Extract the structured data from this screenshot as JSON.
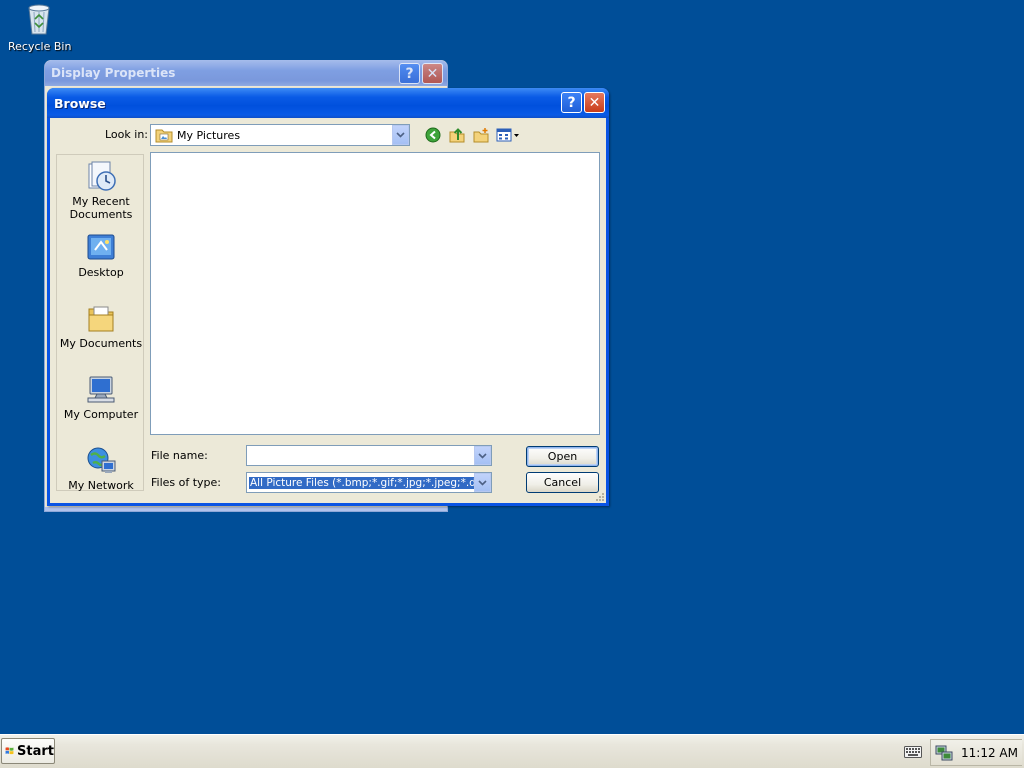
{
  "desktop": {
    "icons": [
      {
        "label": "Recycle Bin",
        "icon": "recycle-bin-icon"
      }
    ]
  },
  "background_window": {
    "title": "Display Properties",
    "help_glyph": "?",
    "close_glyph": "✕"
  },
  "dialog": {
    "title": "Browse",
    "help_glyph": "?",
    "close_glyph": "✕",
    "look_in": {
      "label": "Look in:",
      "value": "My Pictures",
      "icon": "my-pictures-folder-icon"
    },
    "toolbar": [
      {
        "name": "back",
        "icon": "back-arrow-icon"
      },
      {
        "name": "up-one-level",
        "icon": "up-folder-icon"
      },
      {
        "name": "create-new-folder",
        "icon": "new-folder-icon"
      },
      {
        "name": "view-menu",
        "icon": "view-menu-icon"
      }
    ],
    "places": [
      {
        "label": "My Recent Documents",
        "icon": "recent-documents-icon"
      },
      {
        "label": "Desktop",
        "icon": "desktop-icon"
      },
      {
        "label": "My Documents",
        "icon": "my-documents-icon"
      },
      {
        "label": "My Computer",
        "icon": "my-computer-icon"
      },
      {
        "label": "My Network",
        "icon": "my-network-icon"
      }
    ],
    "file_name": {
      "label": "File name:",
      "value": ""
    },
    "files_of_type": {
      "label": "Files of type:",
      "value": "All Picture Files (*.bmp;*.gif;*.jpg;*.jpeg;*.dib;*.pn"
    },
    "buttons": {
      "open": "Open",
      "cancel": "Cancel"
    }
  },
  "taskbar": {
    "start_label": "Start",
    "clock": "11:12 AM"
  },
  "colors": {
    "desktop": "#004e98",
    "title_active": "#0a5be6",
    "dialog_face": "#ece9d8",
    "selection": "#316ac5"
  }
}
